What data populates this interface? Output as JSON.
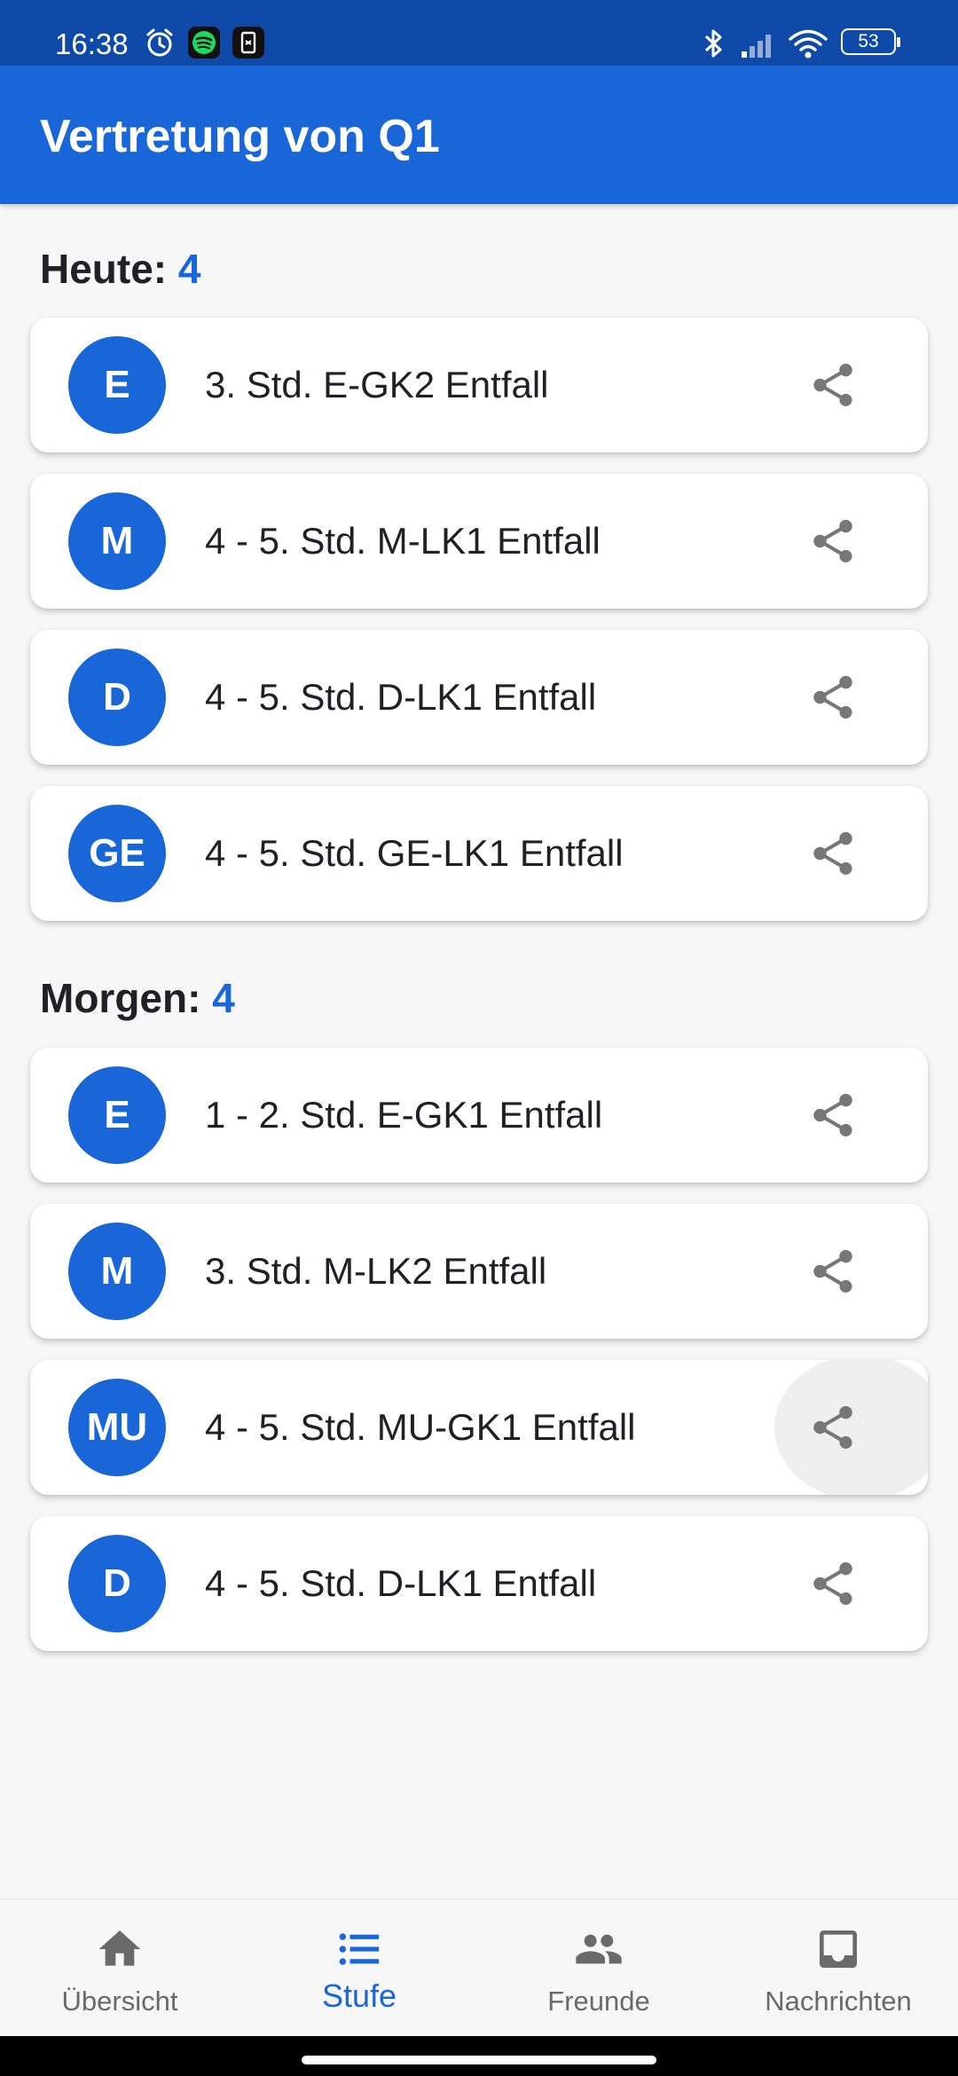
{
  "status_bar": {
    "time": "16:38",
    "battery": "53"
  },
  "app_bar": {
    "title": "Vertretung von Q1"
  },
  "sections": [
    {
      "label": "Heute:",
      "count": "4",
      "items": [
        {
          "initials": "E",
          "text": "3. Std. E-GK2 Entfall"
        },
        {
          "initials": "M",
          "text": "4 - 5. Std. M-LK1 Entfall"
        },
        {
          "initials": "D",
          "text": "4 - 5. Std. D-LK1 Entfall"
        },
        {
          "initials": "GE",
          "text": "4 - 5. Std. GE-LK1 Entfall"
        }
      ]
    },
    {
      "label": "Morgen:",
      "count": "4",
      "items": [
        {
          "initials": "E",
          "text": "1 - 2. Std. E-GK1 Entfall"
        },
        {
          "initials": "M",
          "text": "3. Std. M-LK2 Entfall"
        },
        {
          "initials": "MU",
          "text": "4 - 5. Std. MU-GK1 Entfall"
        },
        {
          "initials": "D",
          "text": "4 - 5. Std. D-LK1 Entfall"
        }
      ]
    }
  ],
  "bottom_nav": {
    "items": [
      {
        "label": "Übersicht",
        "icon": "home-icon"
      },
      {
        "label": "Stufe",
        "icon": "list-icon",
        "active": true
      },
      {
        "label": "Freunde",
        "icon": "people-icon"
      },
      {
        "label": "Nachrichten",
        "icon": "inbox-icon"
      }
    ]
  },
  "colors": {
    "primary": "#1866d8",
    "status_bar": "#104aa8",
    "background": "#f7f7f7",
    "inactive": "#6a6a6a"
  }
}
